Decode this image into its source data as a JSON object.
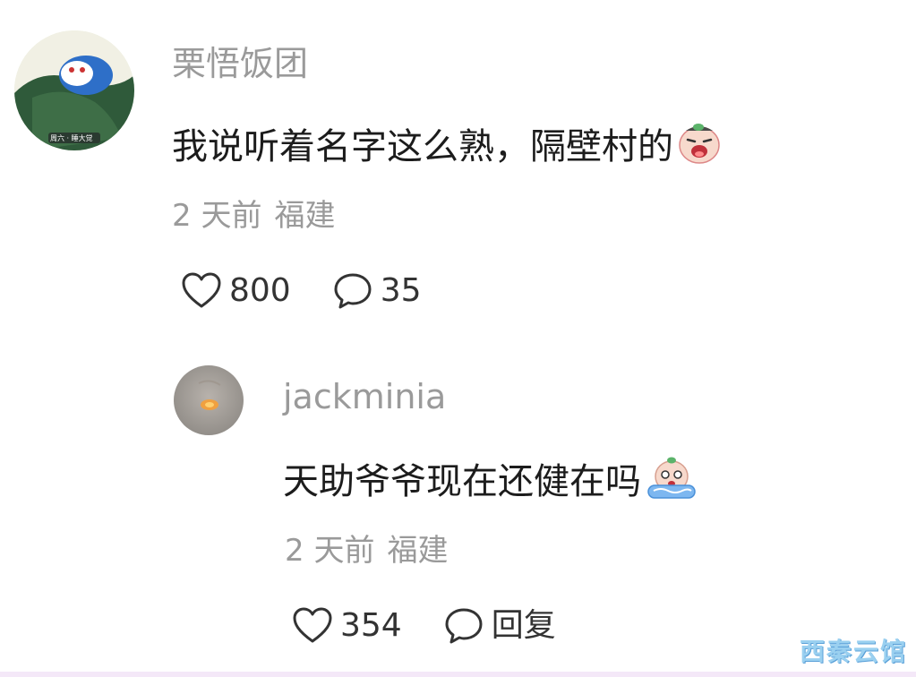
{
  "comments": [
    {
      "username": "栗悟饭团",
      "avatar_label": "周六 · 睡大觉",
      "text": "我说听着名字这么熟，隔壁村的",
      "emoji": "crying-face-emoji",
      "time": "2 天前",
      "location": "福建",
      "likes": "800",
      "replies": "35"
    },
    {
      "username": "jackminia",
      "text": "天助爷爷现在还健在吗",
      "emoji": "crying-tears-emoji",
      "time": "2 天前",
      "location": "福建",
      "likes": "354",
      "reply_label": "回复"
    }
  ],
  "watermark": "西秦云馆",
  "colors": {
    "meta_text": "#9a9a9a",
    "body_text": "#1c1c1c",
    "watermark": "#9ad0f0"
  }
}
